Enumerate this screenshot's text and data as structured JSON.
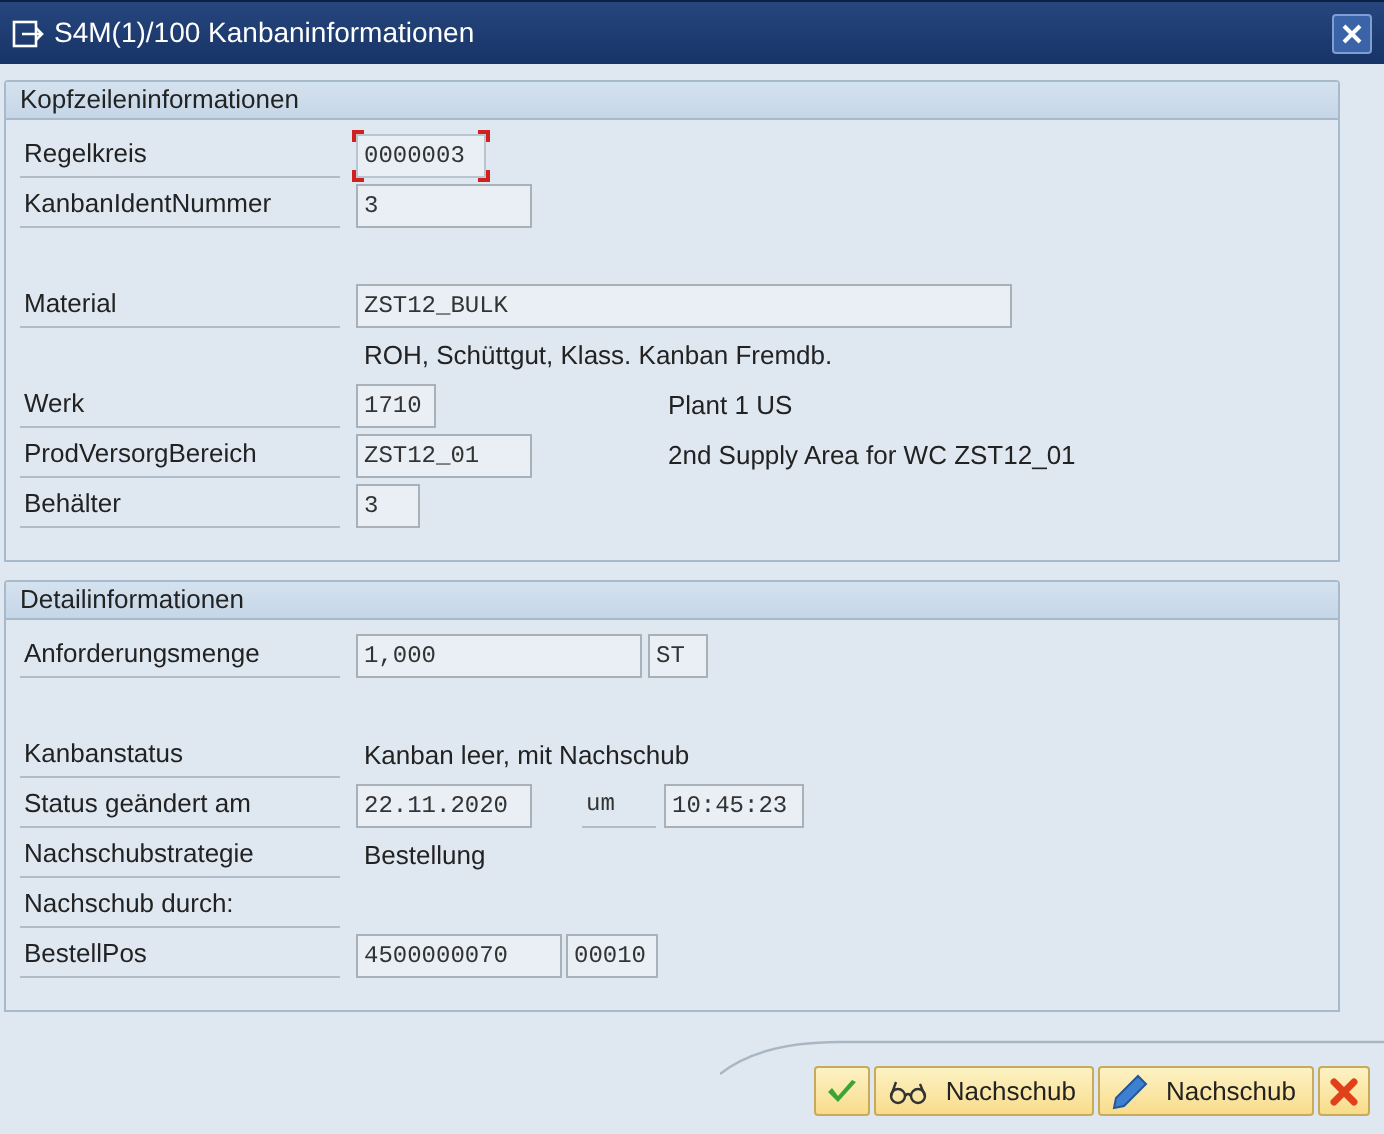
{
  "window": {
    "title": "S4M(1)/100 Kanbaninformationen"
  },
  "sections": [
    {
      "title": "Kopfzeileninformationen",
      "rows": [
        {
          "label": "Regelkreis",
          "items": [
            {
              "kind": "field",
              "value": "0000003",
              "focused": true
            }
          ]
        },
        {
          "label": "KanbanIdentNummer",
          "items": [
            {
              "kind": "field",
              "value": "3",
              "focused": false
            }
          ]
        },
        {
          "label": "Material",
          "items": [
            {
              "kind": "field",
              "value": "ZST12_BULK",
              "focused": false
            }
          ]
        },
        {
          "items": [
            {
              "kind": "text",
              "value": "ROH, Schüttgut, Klass. Kanban Fremdb."
            }
          ]
        },
        {
          "label": "Werk",
          "items": [
            {
              "kind": "field",
              "value": "1710",
              "focused": false
            },
            {
              "kind": "text",
              "value": "Plant 1 US"
            }
          ]
        },
        {
          "label": "ProdVersorgBereich",
          "items": [
            {
              "kind": "field",
              "value": "ZST12_01",
              "focused": false
            },
            {
              "kind": "text",
              "value": "2nd Supply Area for WC ZST12_01"
            }
          ]
        },
        {
          "label": "Behälter",
          "items": [
            {
              "kind": "field",
              "value": "3",
              "focused": false
            }
          ]
        }
      ]
    },
    {
      "title": "Detailinformationen",
      "rows": [
        {
          "label": "Anforderungsmenge",
          "items": [
            {
              "kind": "field",
              "value": "1,000",
              "focused": false
            },
            {
              "kind": "field",
              "value": "ST",
              "focused": false
            }
          ]
        },
        {
          "label": "Kanbanstatus",
          "items": [
            {
              "kind": "text",
              "value": "Kanban leer, mit Nachschub"
            }
          ]
        },
        {
          "label": "Status geändert am",
          "items": [
            {
              "kind": "field",
              "value": "22.11.2020",
              "focused": false
            },
            {
              "kind": "label",
              "value": "um"
            },
            {
              "kind": "field",
              "value": "10:45:23",
              "focused": false
            }
          ]
        },
        {
          "label": "Nachschubstrategie",
          "items": [
            {
              "kind": "text",
              "value": "Bestellung"
            }
          ]
        },
        {
          "label": "Nachschub durch:",
          "items": []
        },
        {
          "label": "BestellPos",
          "items": [
            {
              "kind": "field",
              "value": "4500000070",
              "focused": false
            },
            {
              "kind": "field",
              "value": "00010",
              "focused": false
            }
          ]
        }
      ]
    }
  ],
  "buttons": [
    {
      "kind": "confirm"
    },
    {
      "kind": "display",
      "label": "Nachschub"
    },
    {
      "kind": "edit",
      "label": "Nachschub"
    },
    {
      "kind": "cancel"
    }
  ]
}
